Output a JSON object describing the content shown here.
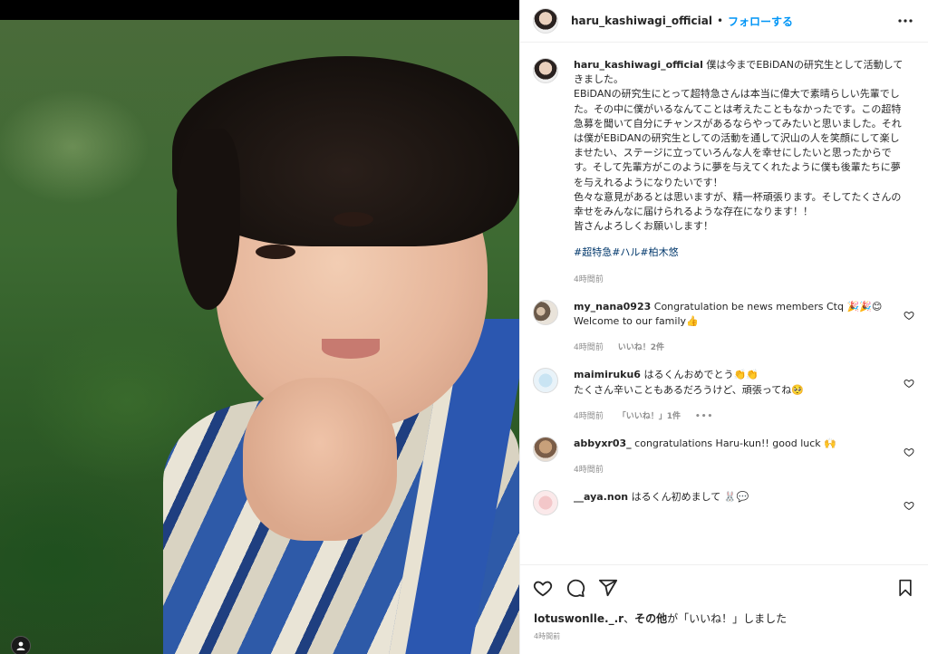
{
  "post": {
    "username": "haru_kashiwagi_official",
    "dot": "•",
    "follow_label": "フォローする",
    "more_icon": "more-horizontal-icon"
  },
  "caption": {
    "username": "haru_kashiwagi_official",
    "text": " 僕は今までEBiDANの研究生として活動してきました。\nEBiDANの研究生にとって超特急さんは本当に偉大で素晴らしい先輩でした。その中に僕がいるなんてことは考えたこともなかったです。この超特急募を聞いて自分にチャンスがあるならやってみたいと思いました。それは僕がEBiDANの研究生としての活動を通して沢山の人を笑顔にして楽しませたい、ステージに立っていろんな人を幸せにしたいと思ったからです。そして先輩方がこのように夢を与えてくれたように僕も後輩たちに夢を与えれるようになりたいです！\n色々な意見があるとは思いますが、精一杯頑張ります。そしてたくさんの幸せをみんなに届けられるような存在になります！！\n皆さんよろしくお願いします！",
    "hashtags": "#超特急#ハル#柏木悠",
    "time": "4時間前"
  },
  "comments": [
    {
      "username": "my_nana0923",
      "text": " Congratulation be news members Ctq",
      "emoji_tail": "🎉🎉😊",
      "line2": "Welcome to our family",
      "line2_emoji": "👍",
      "time": "4時間前",
      "likes": "いいね！2件",
      "more": ""
    },
    {
      "username": "maimiruku6",
      "text": " はるくんおめでとう",
      "emoji_tail": "👏👏",
      "line2": "たくさん辛いこともあるだろうけど、頑張ってね",
      "line2_emoji": "🥺",
      "time": "4時間前",
      "likes": "「いいね！」1件",
      "more": "•••"
    },
    {
      "username": "abbyxr03_",
      "text": " congratulations Haru-kun!! good luck",
      "emoji_tail": "🙌",
      "line2": "",
      "line2_emoji": "",
      "time": "4時間前",
      "likes": "",
      "more": ""
    },
    {
      "username": "__aya.non",
      "text": " はるくん初めまして",
      "emoji_tail": "🐰💬",
      "line2": "",
      "line2_emoji": "",
      "time": "",
      "likes": "",
      "more": ""
    }
  ],
  "actions": {
    "like_icon": "heart-icon",
    "comment_icon": "comment-icon",
    "share_icon": "send-icon",
    "save_icon": "bookmark-icon",
    "liked_by_user": "lotuswonlle._.r",
    "liked_by_sep": "、",
    "liked_by_others": "その他",
    "liked_by_suffix": "が「いいね！」しました",
    "time": "4時間前"
  }
}
